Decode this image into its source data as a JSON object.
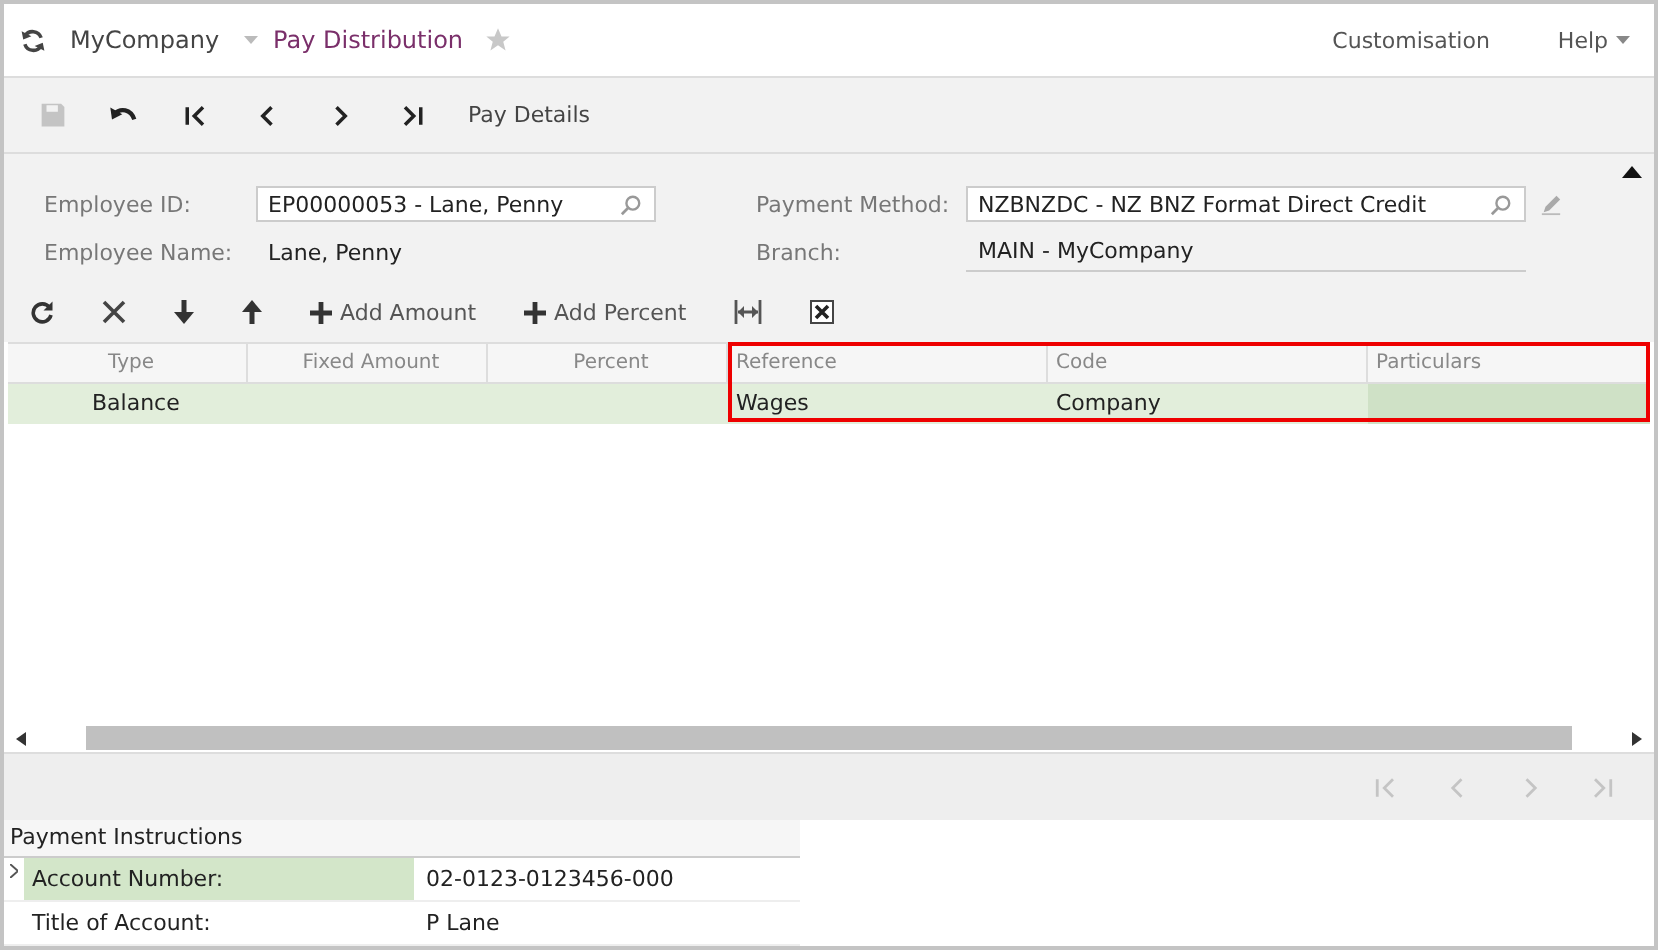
{
  "top_bar": {
    "company": "MyCompany",
    "screen": "Pay Distribution",
    "favorite": false,
    "links": [
      {
        "label": "Customisation",
        "dropdown": false
      },
      {
        "label": "Help",
        "dropdown": true
      }
    ]
  },
  "toolbar": {
    "buttons": [
      {
        "kind": "save",
        "disabled": true
      },
      {
        "kind": "undo",
        "disabled": false
      },
      {
        "kind": "first",
        "disabled": false
      },
      {
        "kind": "prev",
        "disabled": false
      },
      {
        "kind": "next",
        "disabled": false
      },
      {
        "kind": "last",
        "disabled": false
      }
    ],
    "action": "Pay Details"
  },
  "form": {
    "employee_id": {
      "label": "Employee ID:",
      "value": "EP00000053 - Lane, Penny"
    },
    "employee_name": {
      "label": "Employee Name:",
      "value": "Lane, Penny"
    },
    "payment_method": {
      "label": "Payment Method:",
      "value": "NZBNZDC - NZ BNZ Format Direct Credit"
    },
    "branch": {
      "label": "Branch:",
      "value": "MAIN - MyCompany"
    }
  },
  "grid_toolbar": [
    {
      "kind": "refresh"
    },
    {
      "kind": "delete"
    },
    {
      "kind": "down"
    },
    {
      "kind": "up"
    },
    {
      "kind": "add",
      "label": "Add Amount"
    },
    {
      "kind": "add",
      "label": "Add Percent"
    },
    {
      "kind": "fit"
    },
    {
      "kind": "excel"
    }
  ],
  "table": {
    "columns": [
      {
        "label": "Type",
        "highlighted": false
      },
      {
        "label": "Fixed Amount",
        "highlighted": false
      },
      {
        "label": "Percent",
        "highlighted": false
      },
      {
        "label": "Reference",
        "highlighted": true
      },
      {
        "label": "Code",
        "highlighted": true
      },
      {
        "label": "Particulars",
        "highlighted": true
      }
    ],
    "rows": [
      {
        "selected": true,
        "cells": [
          {
            "value": "Balance",
            "focused": false
          },
          {
            "focused": false
          },
          {
            "focused": false
          },
          {
            "value": "Wages",
            "focused": false
          },
          {
            "value": "Company",
            "focused": false
          },
          {
            "focused": true
          }
        ]
      }
    ]
  },
  "pager": [
    {
      "kind": "first",
      "disabled": true
    },
    {
      "kind": "prev",
      "disabled": true
    },
    {
      "kind": "next",
      "disabled": true
    },
    {
      "kind": "last",
      "disabled": true
    }
  ],
  "payment_instructions": {
    "title": "Payment Instructions",
    "rows": [
      {
        "label": "Account Number:",
        "value": "02-0123-0123456-000",
        "selected": true
      },
      {
        "label": "Title of Account:",
        "value": "P Lane",
        "selected": false
      }
    ]
  }
}
